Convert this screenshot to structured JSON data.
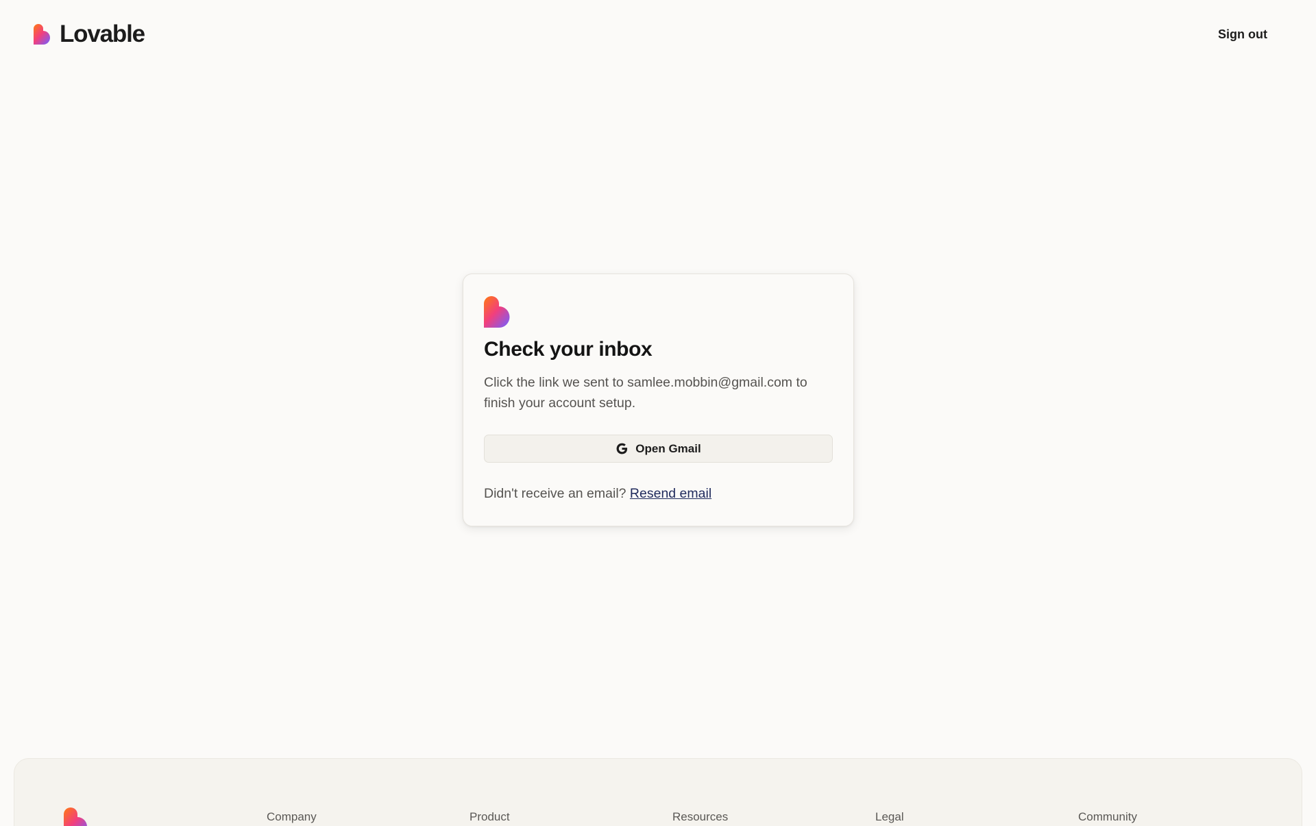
{
  "brand": {
    "name": "Lovable"
  },
  "header": {
    "sign_out_label": "Sign out"
  },
  "card": {
    "title": "Check your inbox",
    "description": "Click the link we sent to samlee.mobbin@gmail.com to finish your account setup.",
    "open_gmail_label": "Open Gmail",
    "resend_prompt": "Didn't receive an email?",
    "resend_link_label": "Resend email"
  },
  "footer": {
    "columns": [
      "Company",
      "Product",
      "Resources",
      "Legal",
      "Community"
    ]
  },
  "icons": {
    "logo": "heart-logo-icon",
    "google": "google-g-icon"
  },
  "colors": {
    "background": "#fbfaf8",
    "footer_background": "#f5f3ee",
    "link": "#1f2a5c",
    "logo_gradient": [
      "#ff6a1a",
      "#f0397a",
      "#8a5cf6"
    ]
  }
}
